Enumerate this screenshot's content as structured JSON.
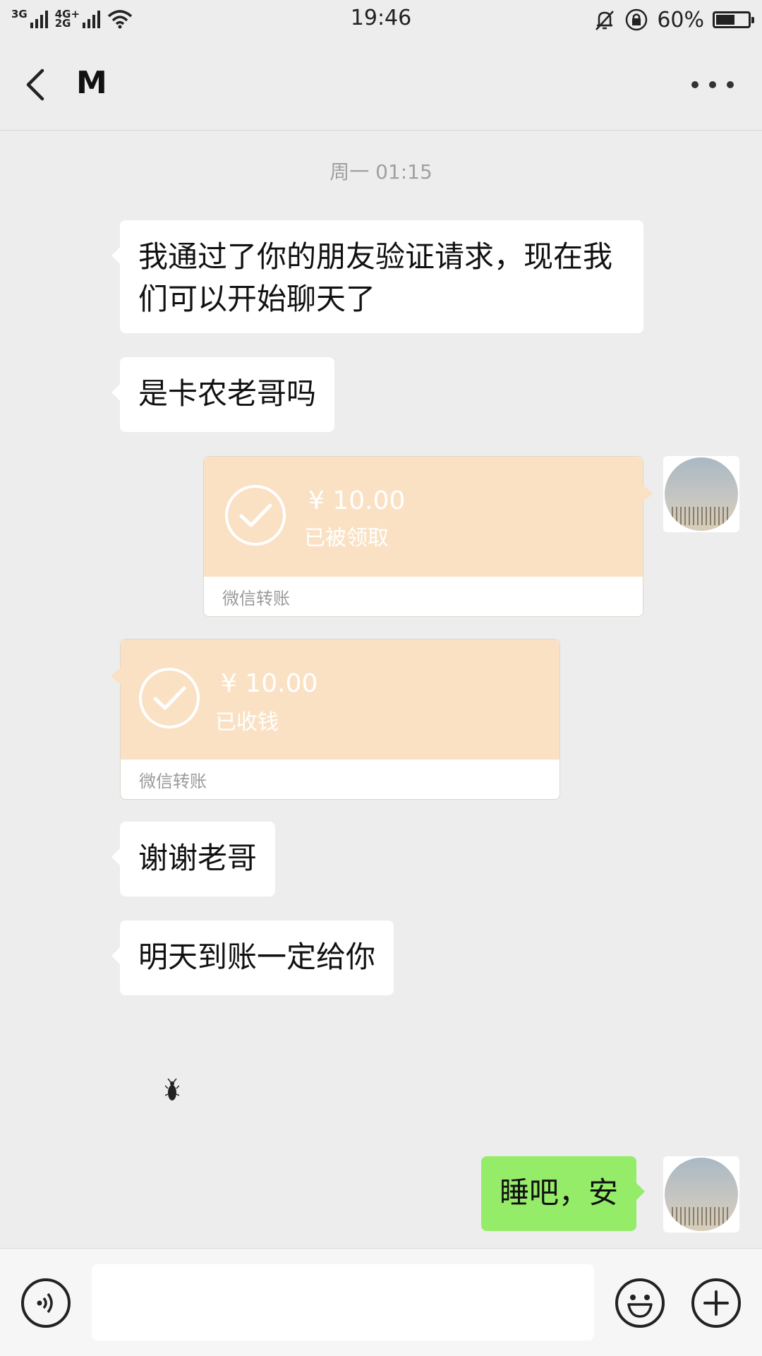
{
  "status_bar": {
    "network_left": "3G",
    "network_right_top": "4G+",
    "network_right_bottom": "2G",
    "time": "19:46",
    "battery_text": "60%",
    "battery_level": 0.6,
    "icons": [
      "signal-icon",
      "wifi-icon",
      "mute-icon",
      "rotation-lock-icon",
      "battery-icon"
    ]
  },
  "nav": {
    "title": "M",
    "icons": [
      "back-icon",
      "more-icon"
    ]
  },
  "chat": {
    "timestamp": "周一 01:15",
    "messages": [
      {
        "side": "left",
        "type": "text",
        "text": "我通过了你的朋友验证请求，现在我们可以开始聊天了"
      },
      {
        "side": "left",
        "type": "text",
        "text": "是卡农老哥吗"
      },
      {
        "side": "right",
        "type": "transfer",
        "amount": "¥ 10.00",
        "status": "已被领取",
        "label": "微信转账"
      },
      {
        "side": "left",
        "type": "transfer",
        "amount": "¥ 10.00",
        "status": "已收钱",
        "label": "微信转账"
      },
      {
        "side": "left",
        "type": "text",
        "text": "谢谢老哥"
      },
      {
        "side": "left",
        "type": "text",
        "text": "明天到账一定给你"
      },
      {
        "side": "right",
        "type": "text",
        "text": "睡吧，安"
      }
    ]
  },
  "input_bar": {
    "placeholder": "",
    "icons": [
      "voice-icon",
      "emoji-icon",
      "plus-icon"
    ]
  },
  "colors": {
    "background": "#ededed",
    "bubble_left": "#ffffff",
    "bubble_right": "#95ec69",
    "transfer_card": "#fae1c4"
  }
}
